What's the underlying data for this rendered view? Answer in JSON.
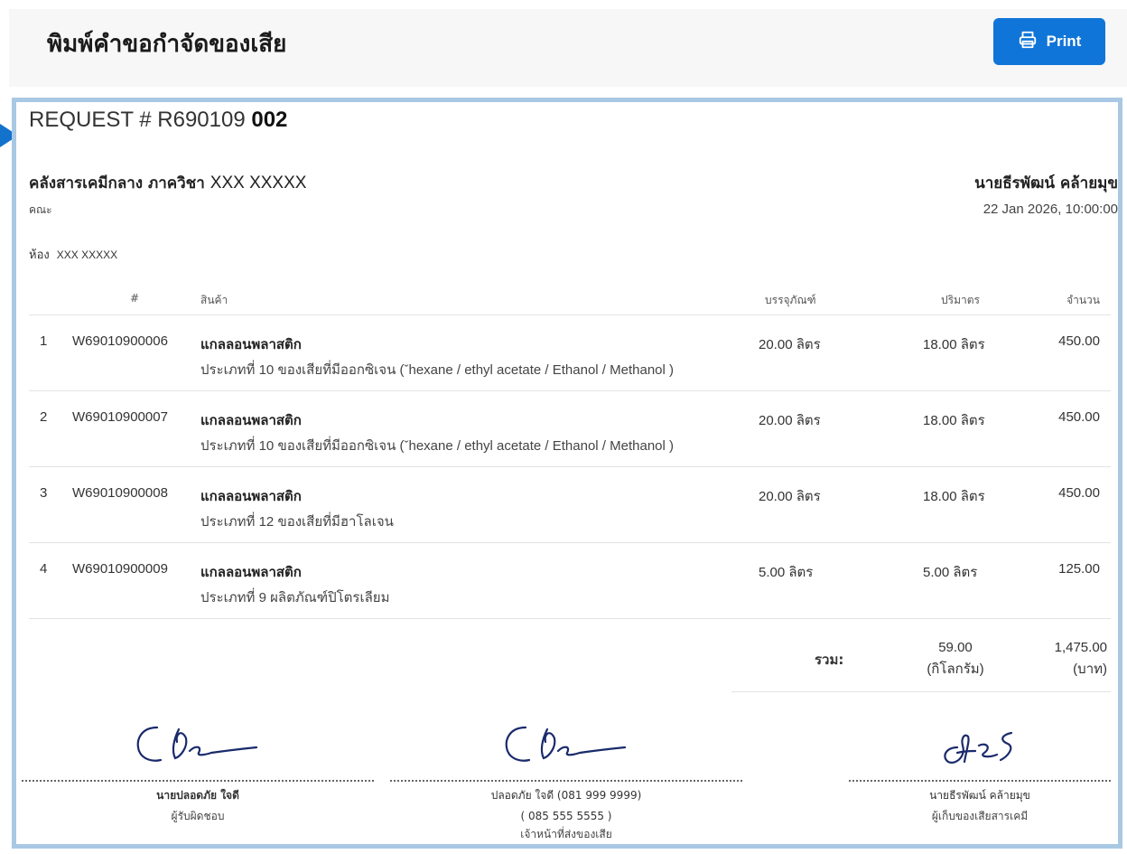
{
  "header": {
    "title": "พิมพ์คำขอกำจัดของเสีย",
    "print_label": "Print"
  },
  "request": {
    "prefix": "REQUEST # R690109",
    "number": "002"
  },
  "requester": {
    "dept_label": "คลังสารเคมีกลาง ภาควิชา",
    "dept_value": "XXX XXXXX",
    "faculty_label": "คณะ",
    "faculty_value": "",
    "room_label": "ห้อง",
    "room_value": "XXX XXXXX",
    "name": "นายธีรพัฒน์ คล้ายมุข",
    "datetime": "22 Jan 2026, 10:00:00"
  },
  "table": {
    "headers": {
      "index": "#",
      "product": "สินค้า",
      "package": "บรรจุภัณฑ์",
      "quantity": "ปริมาตร",
      "amount": "จำนวน"
    },
    "rows": [
      {
        "index": "1",
        "code": "W69010900006",
        "name": "แกลลอนพลาสติก",
        "desc": "ประเภทที่ 10 ของเสียที่มีออกซิเจน (ˇhexane / ethyl acetate / Ethanol / Methanol )",
        "package": "20.00 ลิตร",
        "quantity": "18.00 ลิตร",
        "amount": "450.00"
      },
      {
        "index": "2",
        "code": "W69010900007",
        "name": "แกลลอนพลาสติก",
        "desc": "ประเภทที่ 10 ของเสียที่มีออกซิเจน (ˇhexane / ethyl acetate / Ethanol / Methanol )",
        "package": "20.00 ลิตร",
        "quantity": "18.00 ลิตร",
        "amount": "450.00"
      },
      {
        "index": "3",
        "code": "W69010900008",
        "name": "แกลลอนพลาสติก",
        "desc": "ประเภทที่ 12 ของเสียที่มีฮาโลเจน",
        "package": "20.00 ลิตร",
        "quantity": "18.00 ลิตร",
        "amount": "450.00"
      },
      {
        "index": "4",
        "code": "W69010900009",
        "name": "แกลลอนพลาสติก",
        "desc": "ประเภทที่ 9 ผลิตภัณฑ์ปิโตรเลียม",
        "package": "5.00 ลิตร",
        "quantity": "5.00 ลิตร",
        "amount": "125.00"
      }
    ]
  },
  "totals": {
    "label": "รวม:",
    "kg_value": "59.00",
    "kg_unit": "(กิโลกรัม)",
    "baht_value": "1,475.00",
    "baht_unit": "(บาท)"
  },
  "signatures": [
    {
      "name": "นายปลอดภัย ใจดี",
      "line2": "",
      "role": "ผู้รับผิดชอบ"
    },
    {
      "name": "ปลอดภัย ใจดี (081 999 9999)",
      "line2": "( 085 555 5555 )",
      "role": "เจ้าหน้าที่ส่งของเสีย"
    },
    {
      "name": "นายธีรพัฒน์ คล้ายมุข",
      "line2": "",
      "role": "ผู้เก็บของเสียสารเคมี"
    }
  ],
  "colors": {
    "accent": "#1075d8",
    "doc_border": "#a9c8e4"
  },
  "icons": {
    "print": "printer-icon"
  }
}
